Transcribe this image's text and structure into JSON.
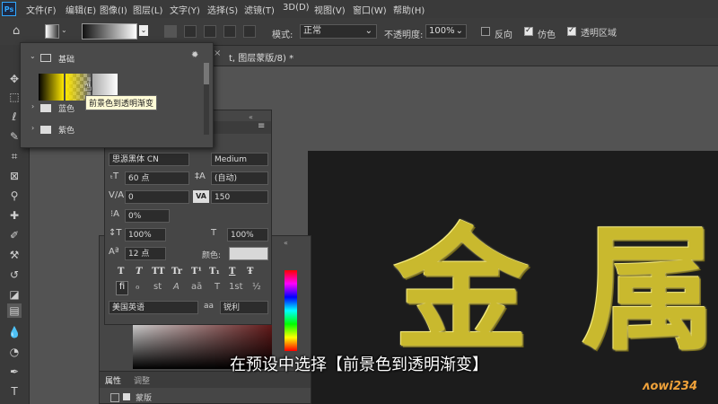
{
  "app": {
    "logo": "Ps"
  },
  "menu": [
    "文件(F)",
    "编辑(E)",
    "图像(I)",
    "图层(L)",
    "文字(Y)",
    "选择(S)",
    "滤镜(T)",
    "3D(D)",
    "视图(V)",
    "窗口(W)",
    "帮助(H)"
  ],
  "options": {
    "mode_label": "模式:",
    "mode_value": "正常",
    "opacity_label": "不透明度:",
    "opacity_value": "100%",
    "reverse_label": "反向",
    "dither_label": "仿色",
    "transparency_label": "透明区域",
    "reverse_checked": false,
    "dither_checked": true,
    "transparency_checked": true
  },
  "tab": {
    "label": "t, 图层蒙版/8) *"
  },
  "gradient_picker": {
    "groups": [
      "基础",
      "蓝色",
      "紫色"
    ],
    "tooltip": "前景色到透明渐变"
  },
  "character": {
    "font_family": "思源黑体 CN",
    "font_style": "Medium",
    "size": "60 点",
    "leading": "(自动)",
    "kerning": "0",
    "tracking": "150",
    "scale_percent": "0%",
    "vertical_scale": "100%",
    "horizontal_scale": "100%",
    "baseline": "12 点",
    "color_label": "颜色:",
    "style_buttons": [
      "T",
      "T",
      "TT",
      "Tr",
      "T¹",
      "T₁",
      "T",
      "Ŧ"
    ],
    "opentype_buttons": [
      "fi",
      "ℴ",
      "st",
      "A",
      "aā",
      "T",
      "1st",
      "½"
    ],
    "language": "美国英语",
    "aa_label": "aa",
    "antialias": "锐利"
  },
  "properties": {
    "tabs": [
      "属性",
      "调整"
    ],
    "layer_label": "蒙版"
  },
  "canvas_text": [
    "金",
    "属"
  ],
  "subtitle": "在预设中选择【前景色到透明渐变】",
  "watermark": "ʌowi234",
  "colors": {
    "accent": "#31a8ff",
    "gold": "#c9b92e",
    "tooltip_bg": "#fffbd6",
    "canvas_bg": "#1c1c1c"
  }
}
